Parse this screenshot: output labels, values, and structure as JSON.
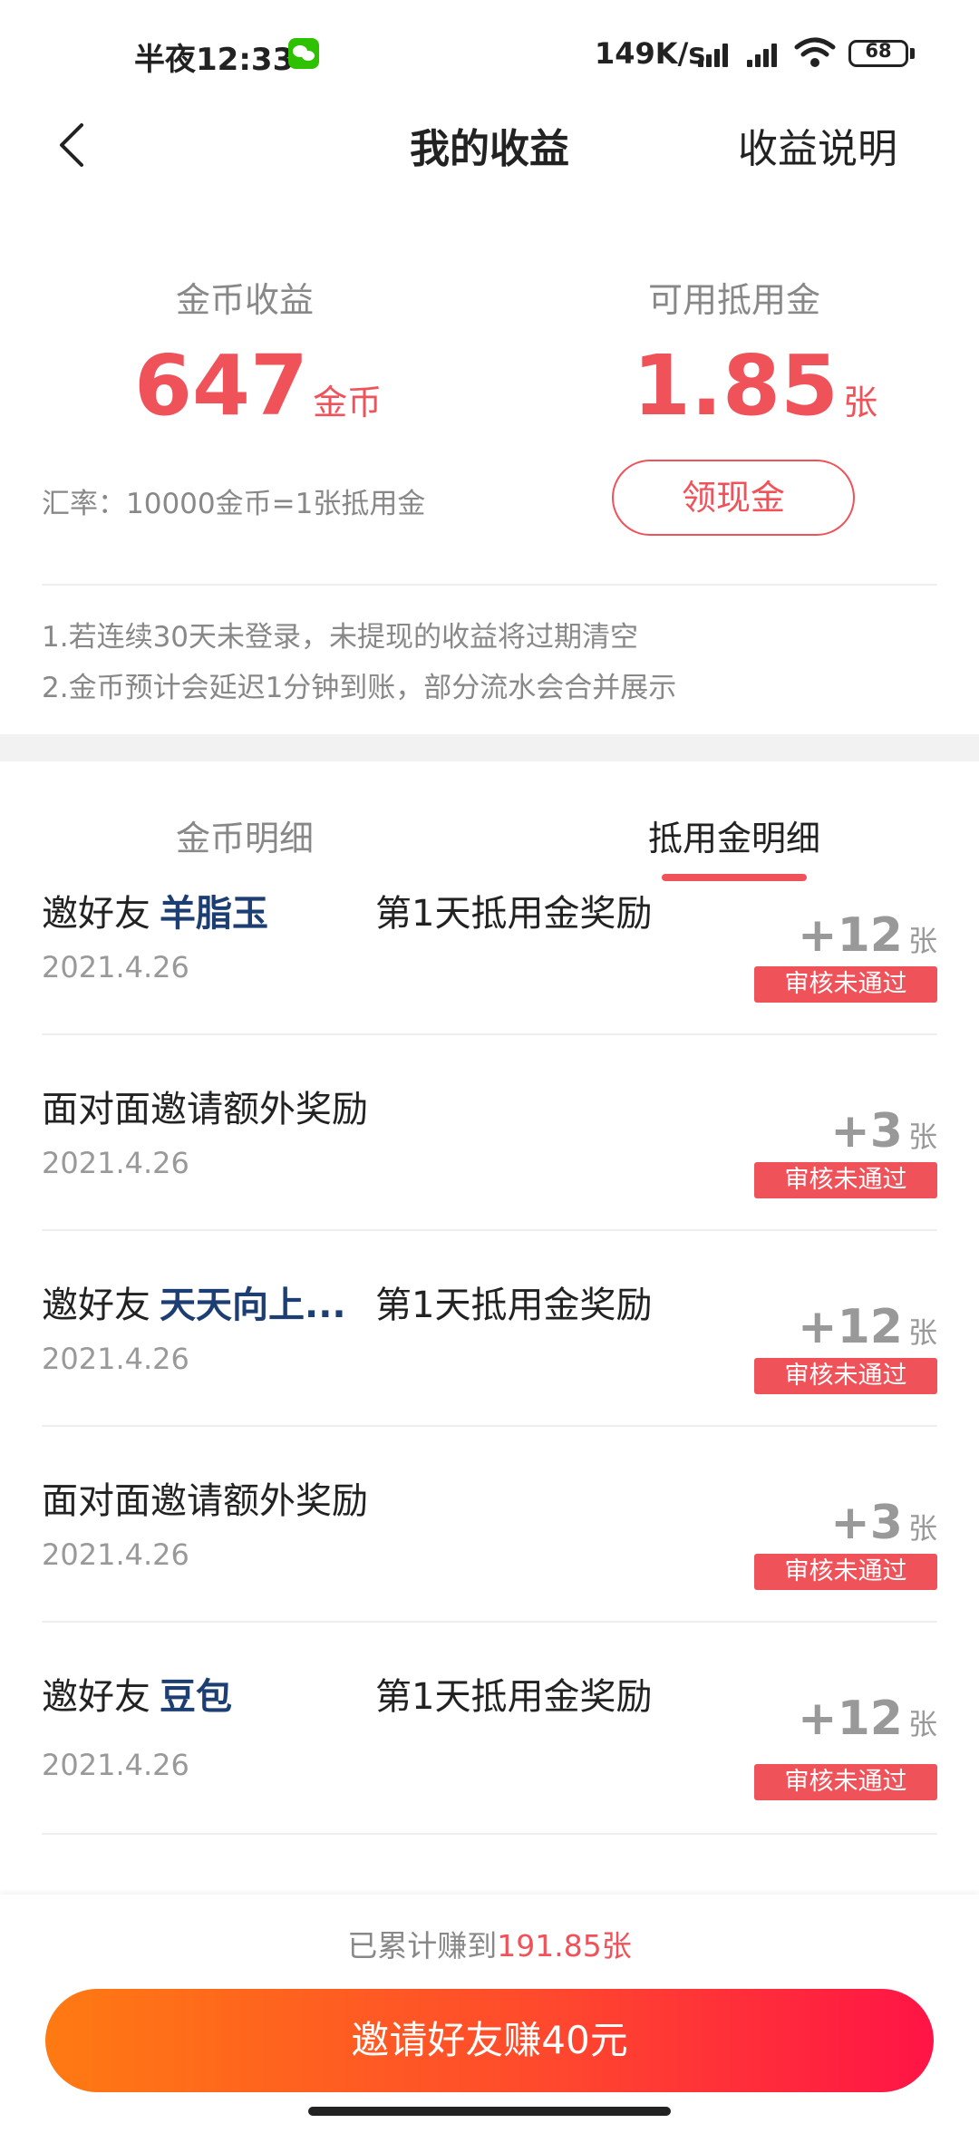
{
  "status_bar": {
    "time": "半夜12:33",
    "net_speed": "149K/s",
    "battery": "68"
  },
  "nav": {
    "title": "我的收益",
    "explain": "收益说明"
  },
  "summary": {
    "coin_label": "金币收益",
    "coin_value": "647",
    "coin_unit": "金币",
    "voucher_label": "可用抵用金",
    "voucher_value": "1.85",
    "voucher_unit": "张",
    "rate": "汇率：10000金币=1张抵用金",
    "withdraw_button": "领现金",
    "notes": [
      "1.若连续30天未登录，未提现的收益将过期清空",
      "2.金币预计会延迟1分钟到账，部分流水会合并展示"
    ]
  },
  "tabs": [
    "金币明细",
    "抵用金明细"
  ],
  "active_tab": 1,
  "records": [
    {
      "title": "邀好友",
      "friend": "羊脂玉",
      "reward": "第1天抵用金奖励",
      "date": "2021.4.26",
      "amount": "+12",
      "unit": "张",
      "status": "审核未通过"
    },
    {
      "title": "面对面邀请额外奖励",
      "friend": "",
      "reward": "",
      "date": "2021.4.26",
      "amount": "+3",
      "unit": "张",
      "status": "审核未通过"
    },
    {
      "title": "邀好友",
      "friend": "天天向上...",
      "reward": "第1天抵用金奖励",
      "date": "2021.4.26",
      "amount": "+12",
      "unit": "张",
      "status": "审核未通过"
    },
    {
      "title": "面对面邀请额外奖励",
      "friend": "",
      "reward": "",
      "date": "2021.4.26",
      "amount": "+3",
      "unit": "张",
      "status": "审核未通过"
    },
    {
      "title": "邀好友",
      "friend": "豆包",
      "reward": "第1天抵用金奖励",
      "date": "2021.4.26",
      "amount": "+12",
      "unit": "张",
      "status": "审核未通过"
    }
  ],
  "footer": {
    "total_prefix": "已累计赚到",
    "total_value": "191.85张",
    "invite_button": "邀请好友赚40元"
  },
  "colors": {
    "accent": "#f0525a",
    "friend_name": "#1d3e72",
    "invite_gradient_start": "#ff7a12",
    "invite_gradient_end": "#ff1446"
  }
}
